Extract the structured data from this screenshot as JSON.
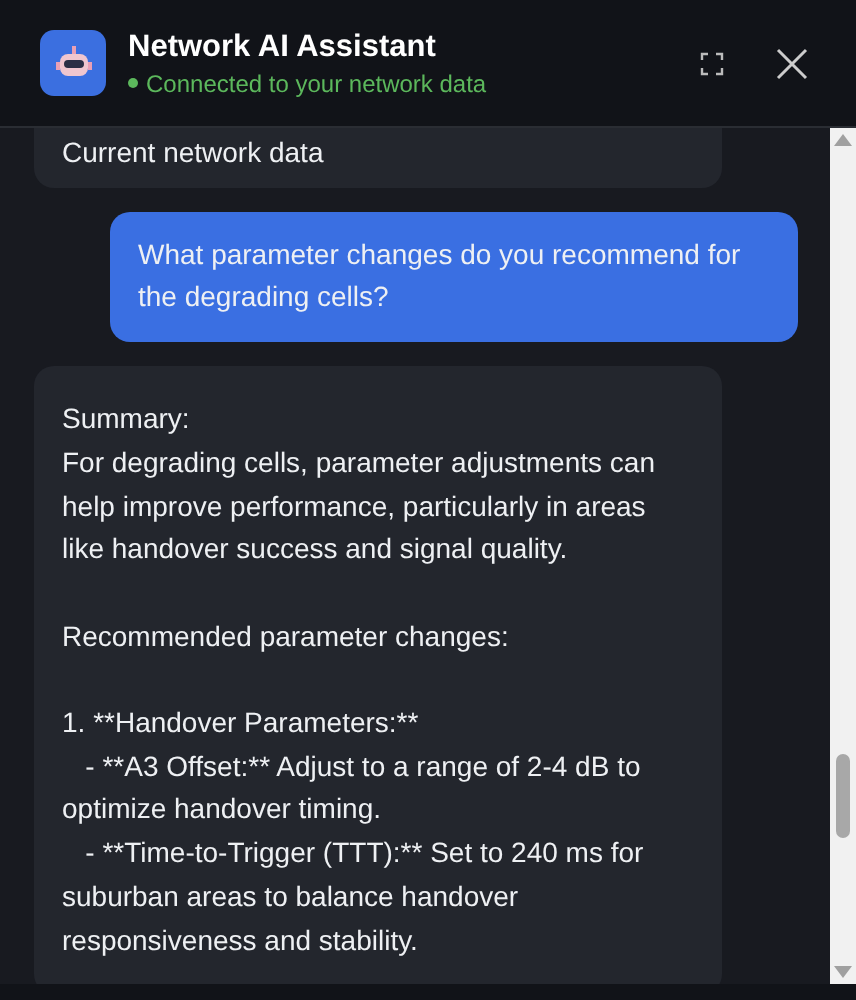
{
  "header": {
    "title": "Network AI Assistant",
    "status": "Connected to your network data",
    "connected": true
  },
  "messages": [
    {
      "kind": "assistant",
      "text": "Current network data"
    },
    {
      "kind": "user",
      "text": "What parameter changes do you recommend for the degrading cells?"
    },
    {
      "kind": "assistant",
      "text": "Summary:\nFor degrading cells, parameter adjustments can help improve performance, particularly in areas like handover success and signal quality.\n\nRecommended parameter changes:\n\n1. **Handover Parameters:**\n   - **A3 Offset:** Adjust to a range of 2-4 dB to optimize handover timing.\n   - **Time-to-Trigger (TTT):** Set to 240 ms for suburban areas to balance handover responsiveness and stability."
    }
  ]
}
